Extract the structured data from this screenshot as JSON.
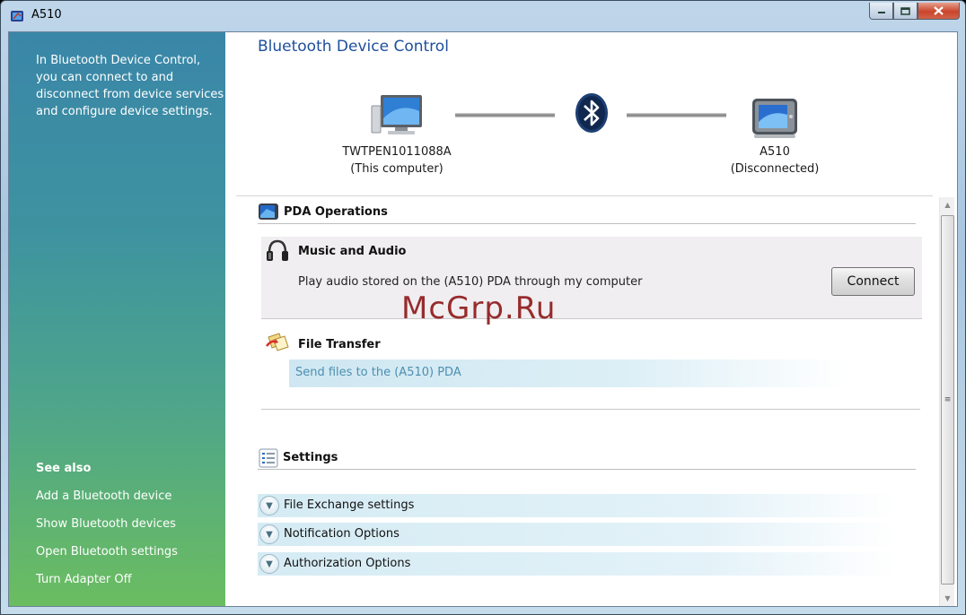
{
  "window": {
    "title": "A510",
    "minimize_icon": "minimize-icon",
    "maximize_icon": "maximize-icon",
    "close_icon": "close-icon"
  },
  "left_pane": {
    "intro_lines": [
      "In Bluetooth Device Control,",
      "you can connect to and",
      "disconnect from device services",
      "and configure device settings."
    ],
    "see_also_title": "See also",
    "links": [
      "Add a Bluetooth device",
      "Show Bluetooth devices",
      "Open Bluetooth settings",
      "Turn Adapter Off"
    ]
  },
  "header": {
    "title": "Bluetooth Device Control"
  },
  "devices": {
    "computer": {
      "name": "TWTPEN1011088A",
      "status": "(This computer)",
      "icon": "computer-icon"
    },
    "bluetooth_icon": "bluetooth-icon",
    "pda": {
      "name": "A510",
      "status": "(Disconnected)",
      "icon": "pda-icon"
    }
  },
  "pda_operations": {
    "heading": "PDA Operations",
    "services": [
      {
        "title": "Music and Audio",
        "description": "Play audio stored on the (A510) PDA through my computer",
        "button": "Connect",
        "icon": "headphones-icon"
      },
      {
        "title": "File Transfer",
        "link": "Send files to the (A510) PDA",
        "icon": "file-transfer-icon"
      }
    ]
  },
  "settings": {
    "heading": "Settings",
    "options": [
      "File Exchange settings",
      "Notification Options",
      "Authorization Options"
    ]
  },
  "watermark": "McGrp.Ru",
  "colors": {
    "title_blue": "#1e4f9c",
    "link_blue": "#4d8fb0",
    "pane_top": "#3a86a8",
    "pane_bottom": "#6bbd60"
  }
}
